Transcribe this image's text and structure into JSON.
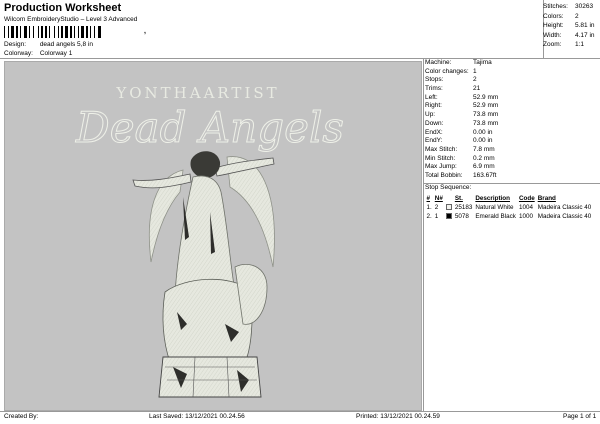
{
  "header": {
    "title": "Production Worksheet",
    "software": "Wilcom EmbroideryStudio – Level 3 Advanced",
    "barcode_suffix": ","
  },
  "meta": {
    "design_label": "Design:",
    "design_value": "dead angels 5,8 in",
    "colorway_label": "Colorway:",
    "colorway_value": "Colorway 1"
  },
  "summary": {
    "stitches_label": "Stitches:",
    "stitches_value": "30263",
    "colors_label": "Colors:",
    "colors_value": "2",
    "height_label": "Height:",
    "height_value": "5.81 in",
    "width_label": "Width:",
    "width_value": "4.17 in",
    "zoom_label": "Zoom:",
    "zoom_value": "1:1"
  },
  "design": {
    "text_line1": "YONTHAARTIST",
    "text_line2": "Dead Angels",
    "fill_color": "#e6e8df",
    "background_color": "#c3c3c3"
  },
  "params": [
    {
      "label": "Machine:",
      "value": "Tajima"
    },
    {
      "label": "Color changes:",
      "value": "1"
    },
    {
      "label": "Stops:",
      "value": "2"
    },
    {
      "label": "Trims:",
      "value": "21"
    },
    {
      "label": "Left:",
      "value": "52.9 mm"
    },
    {
      "label": "Right:",
      "value": "52.9 mm"
    },
    {
      "label": "Up:",
      "value": "73.8 mm"
    },
    {
      "label": "Down:",
      "value": "73.8 mm"
    },
    {
      "label": "EndX:",
      "value": "0.00 in"
    },
    {
      "label": "EndY:",
      "value": "0.00 in"
    },
    {
      "label": "Max Stitch:",
      "value": "7.8 mm"
    },
    {
      "label": "Min Stitch:",
      "value": "0.2 mm"
    },
    {
      "label": "Max Jump:",
      "value": "6.9 mm"
    },
    {
      "label": "Total Bobbin:",
      "value": "163.67ft"
    }
  ],
  "stop_sequence": {
    "title": "Stop Sequence:",
    "headers": [
      "#",
      "N#",
      "",
      "St.",
      "Description",
      "Code",
      "Brand"
    ],
    "rows": [
      {
        "index": "1.",
        "needle": "2",
        "color": "#f2f2ee",
        "stitches": "25183",
        "description": "Natural White",
        "code": "1004",
        "brand": "Madeira Classic 40"
      },
      {
        "index": "2.",
        "needle": "1",
        "color": "#000000",
        "stitches": "5078",
        "description": "Emerald Black",
        "code": "1000",
        "brand": "Madeira Classic 40"
      }
    ]
  },
  "footer": {
    "created_by": "Created By:",
    "last_saved": "Last Saved: 13/12/2021 00.24.56",
    "printed": "Printed: 13/12/2021 00.24.59",
    "page": "Page 1 of 1"
  }
}
